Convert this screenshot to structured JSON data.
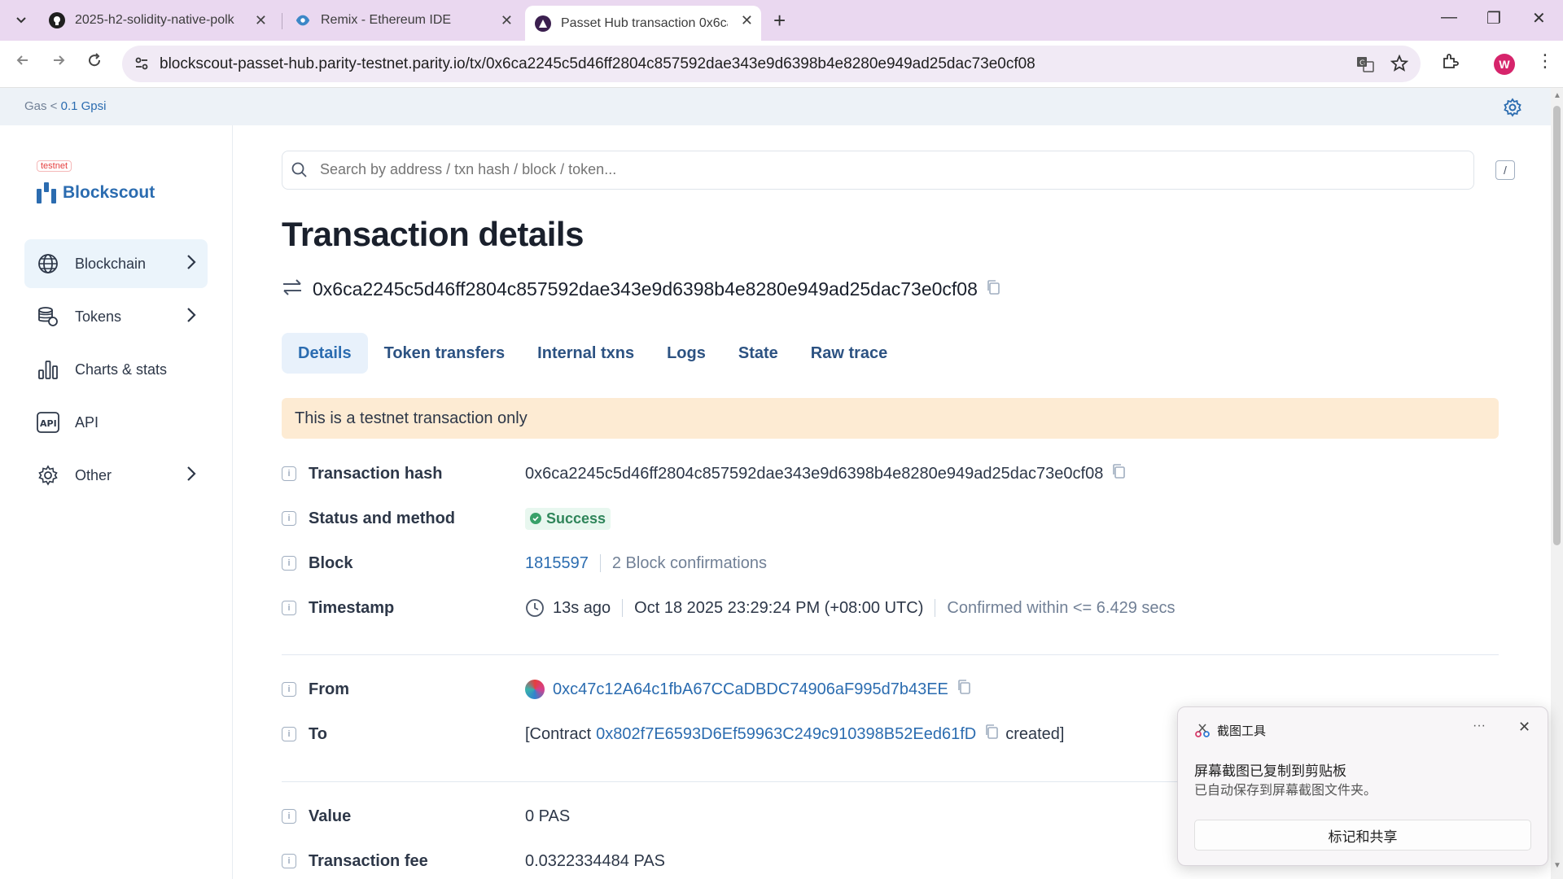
{
  "browser": {
    "tabs": [
      {
        "label": "2025-h2-solidity-native-polk",
        "icon": "github-icon"
      },
      {
        "label": "Remix - Ethereum IDE",
        "icon": "remix-icon"
      },
      {
        "label": "Passet Hub transaction 0x6ca",
        "icon": "blockscout-tab-icon"
      }
    ],
    "url": "blockscout-passet-hub.parity-testnet.parity.io/tx/0x6ca2245c5d46ff2804c857592dae343e9d6398b4e8280e949ad25dac73e0cf08",
    "profile_initial": "W"
  },
  "topbar": {
    "gas_label": "Gas <",
    "gas_value": "0.1 Gpsi"
  },
  "sidebar": {
    "badge": "testnet",
    "logo": "Blockscout",
    "items": [
      {
        "label": "Blockchain",
        "icon": "globe-icon"
      },
      {
        "label": "Tokens",
        "icon": "coins-icon"
      },
      {
        "label": "Charts & stats",
        "icon": "bar-chart-icon"
      },
      {
        "label": "API",
        "icon": "api-icon"
      },
      {
        "label": "Other",
        "icon": "gear-icon"
      }
    ]
  },
  "search": {
    "placeholder": "Search by address / txn hash / block / token...",
    "shortcut": "/"
  },
  "page": {
    "title": "Transaction details",
    "hash": "0x6ca2245c5d46ff2804c857592dae343e9d6398b4e8280e949ad25dac73e0cf08",
    "tabs": [
      "Details",
      "Token transfers",
      "Internal txns",
      "Logs",
      "State",
      "Raw trace"
    ],
    "alert": "This is a testnet transaction only"
  },
  "details": {
    "tx_hash_label": "Transaction hash",
    "tx_hash": "0x6ca2245c5d46ff2804c857592dae343e9d6398b4e8280e949ad25dac73e0cf08",
    "status_label": "Status and method",
    "status": "Success",
    "block_label": "Block",
    "block": "1815597",
    "confirmations": "2 Block confirmations",
    "timestamp_label": "Timestamp",
    "ago": "13s ago",
    "timestamp": "Oct 18 2025 23:29:24 PM (+08:00 UTC)",
    "confirmed": "Confirmed within <= 6.429 secs",
    "from_label": "From",
    "from": "0xc47c12A64c1fbA67CCaDBDC74906aF995d7b43EE",
    "to_label": "To",
    "to_prefix": "[Contract",
    "to": "0x802f7E6593D6Ef59963C249c910398B52Eed61fD",
    "to_suffix": "created]",
    "value_label": "Value",
    "value": "0 PAS",
    "fee_label": "Transaction fee",
    "fee": "0.0322334484 PAS"
  },
  "toast": {
    "title": "截图工具",
    "more": "···",
    "message": "屏幕截图已复制到剪贴板",
    "sub": "已自动保存到屏幕截图文件夹。",
    "button": "标记和共享"
  }
}
